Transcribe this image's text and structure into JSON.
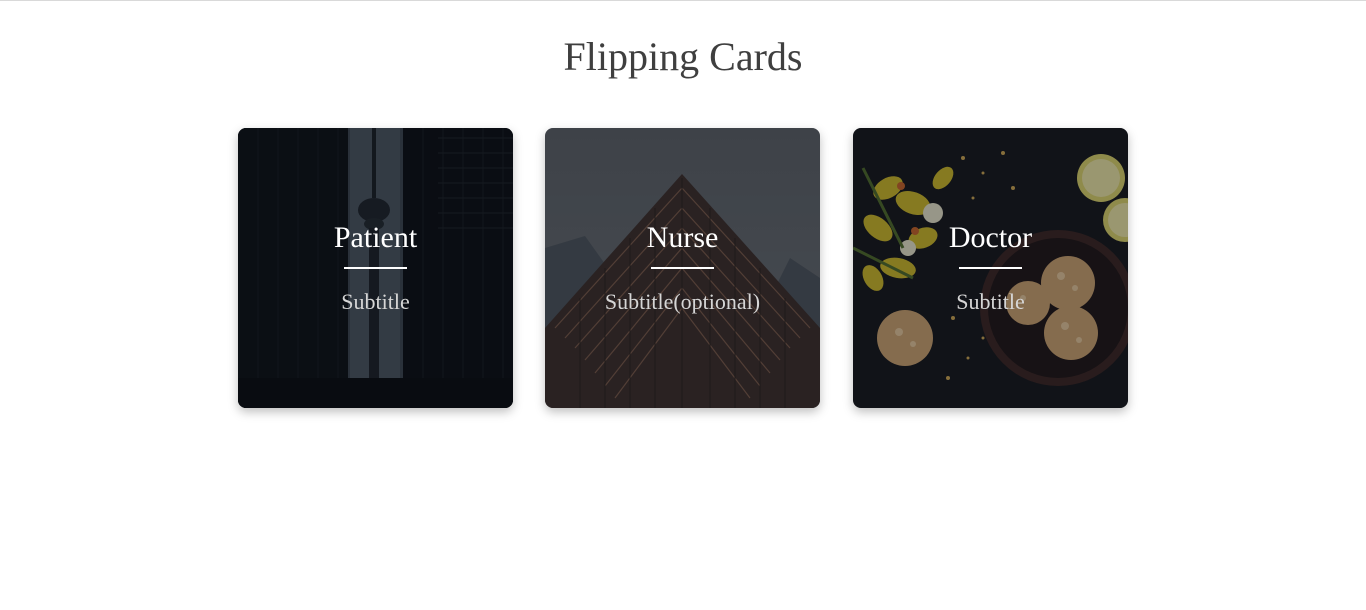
{
  "page": {
    "title": "Flipping Cards"
  },
  "cards": [
    {
      "title": "Patient",
      "subtitle": "Subtitle",
      "image": "city-tower-photo"
    },
    {
      "title": "Nurse",
      "subtitle": "Subtitle(optional)",
      "image": "building-facade-photo"
    },
    {
      "title": "Doctor",
      "subtitle": "Subtitle",
      "image": "food-flatlay-photo"
    }
  ],
  "colors": {
    "title_text": "#3f3f3f",
    "card_title_text": "#ffffff",
    "card_subtitle_text": "#d6d6d6",
    "card_overlay": "#0a0c10"
  }
}
